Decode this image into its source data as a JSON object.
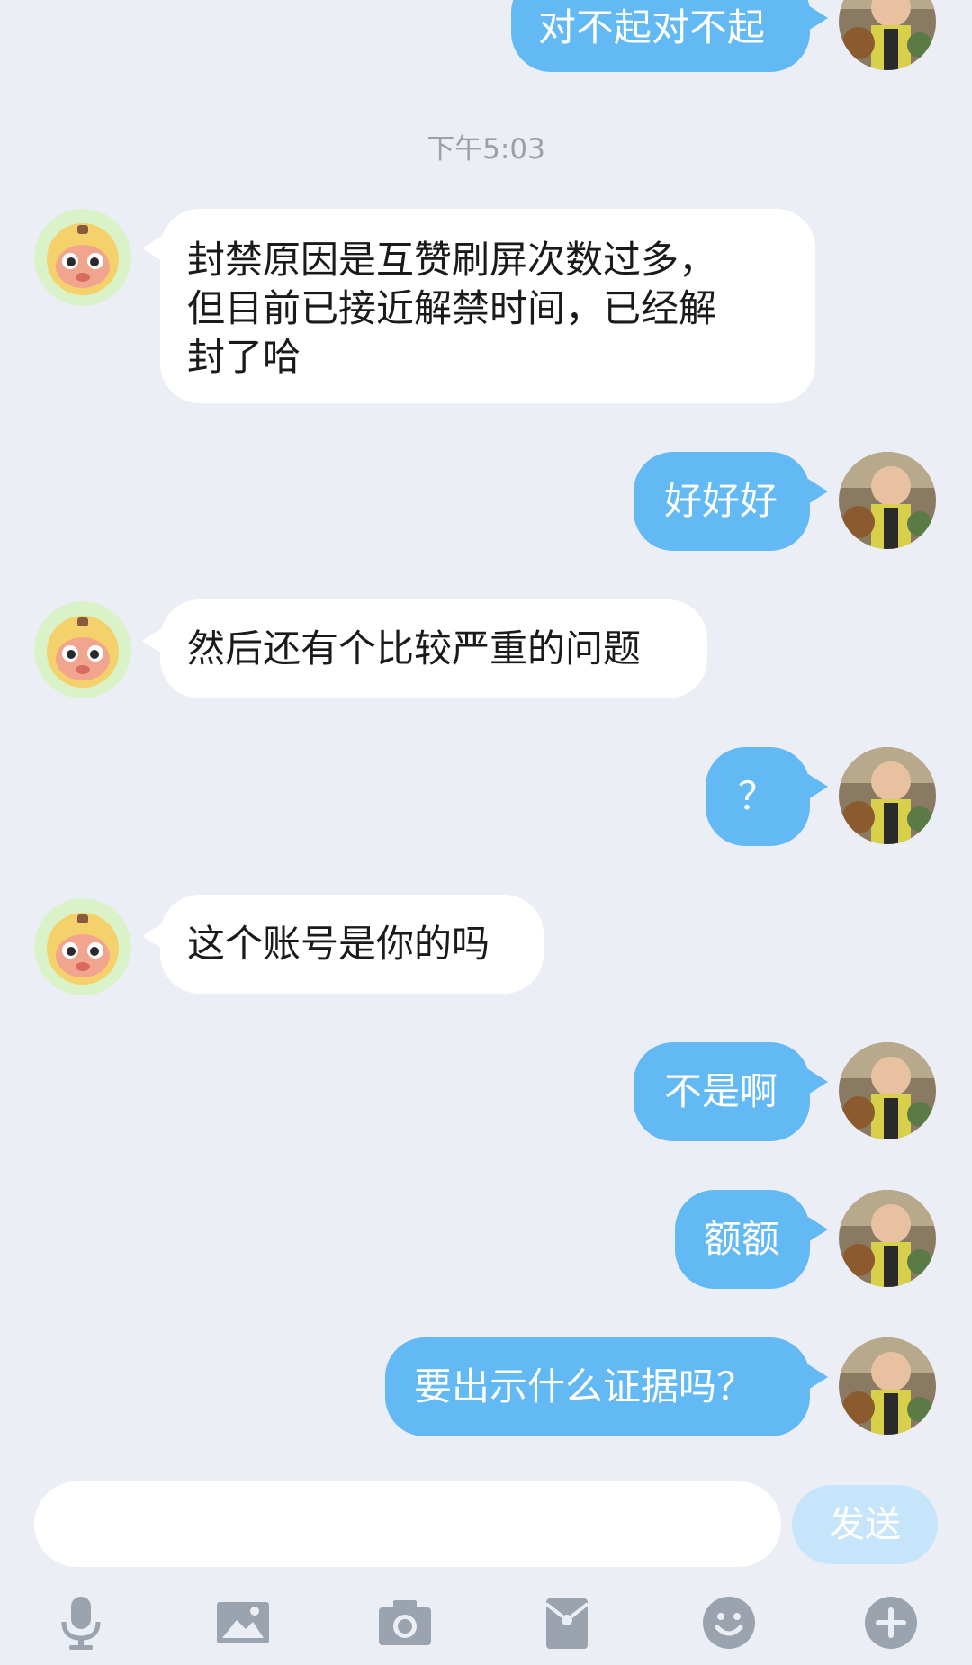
{
  "colors": {
    "background": "#eceef5",
    "outgoing_bubble": "#62b9f3",
    "incoming_bubble": "#ffffff",
    "send_button": "#c6e5fa",
    "toolbar_icon": "#9aa3ae"
  },
  "timestamp": "下午5:03",
  "messages": [
    {
      "from": "me",
      "text": "对不起对不起"
    },
    {
      "from": "them",
      "text": "封禁原因是互赞刷屏次数过多，\n但目前已接近解禁时间，已经解\n封了哈"
    },
    {
      "from": "me",
      "text": "好好好"
    },
    {
      "from": "them",
      "text": "然后还有个比较严重的问题"
    },
    {
      "from": "me",
      "text": "？"
    },
    {
      "from": "them",
      "text": "这个账号是你的吗"
    },
    {
      "from": "me",
      "text": "不是啊"
    },
    {
      "from": "me",
      "text": "额额"
    },
    {
      "from": "me",
      "text": "要出示什么证据吗？"
    }
  ],
  "input": {
    "placeholder": "",
    "send_label": "发送"
  },
  "toolbar": [
    "microphone-icon",
    "image-icon",
    "camera-icon",
    "red-packet-icon",
    "emoji-icon",
    "plus-icon"
  ]
}
